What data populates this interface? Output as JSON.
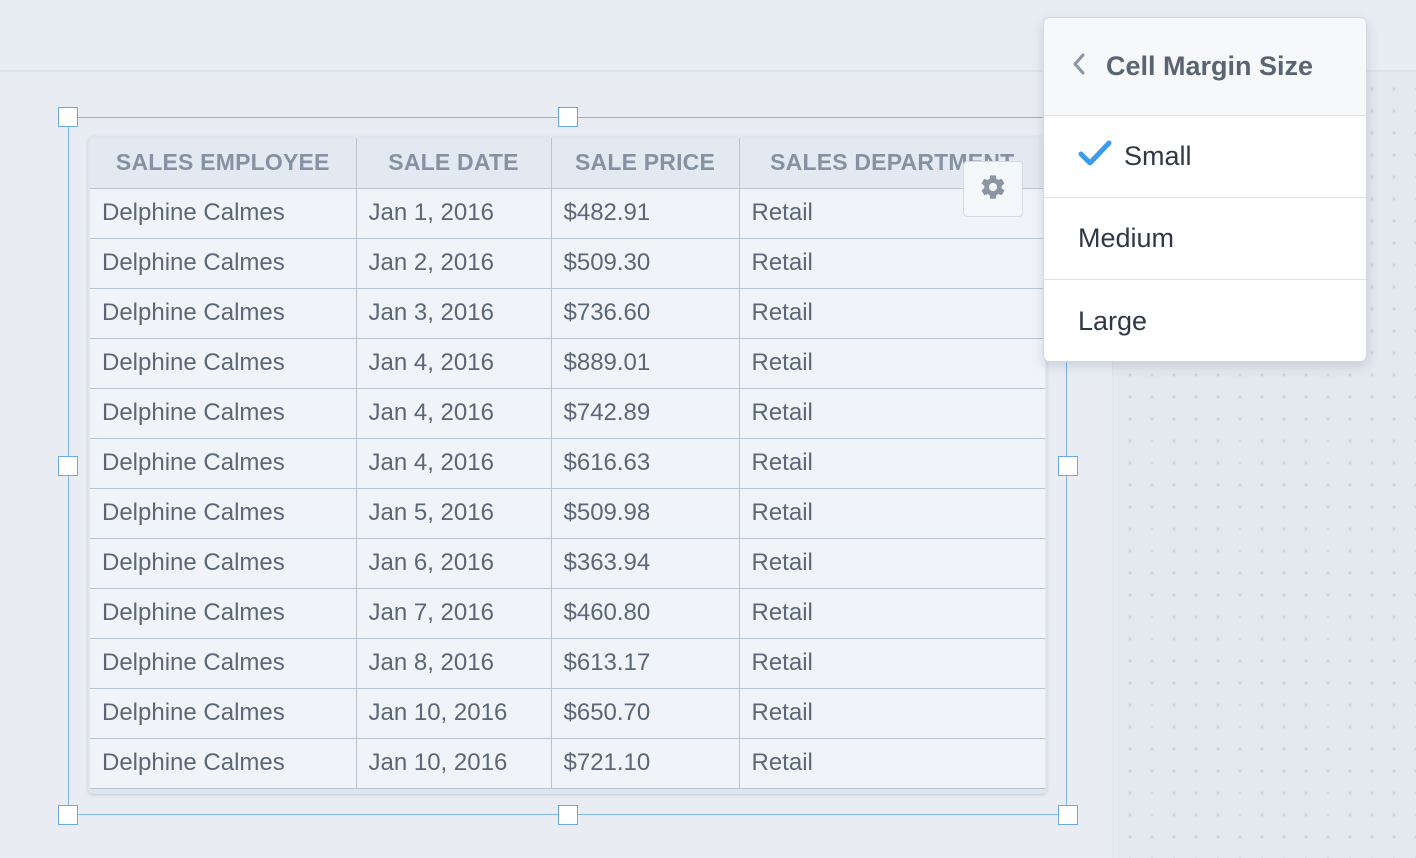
{
  "table": {
    "columns": [
      "SALES EMPLOYEE",
      "SALE DATE",
      "SALE PRICE",
      "SALES DEPARTMENT"
    ],
    "rows": [
      [
        "Delphine Calmes",
        "Jan 1, 2016",
        "$482.91",
        "Retail"
      ],
      [
        "Delphine Calmes",
        "Jan 2, 2016",
        "$509.30",
        "Retail"
      ],
      [
        "Delphine Calmes",
        "Jan 3, 2016",
        "$736.60",
        "Retail"
      ],
      [
        "Delphine Calmes",
        "Jan 4, 2016",
        "$889.01",
        "Retail"
      ],
      [
        "Delphine Calmes",
        "Jan 4, 2016",
        "$742.89",
        "Retail"
      ],
      [
        "Delphine Calmes",
        "Jan 4, 2016",
        "$616.63",
        "Retail"
      ],
      [
        "Delphine Calmes",
        "Jan 5, 2016",
        "$509.98",
        "Retail"
      ],
      [
        "Delphine Calmes",
        "Jan 6, 2016",
        "$363.94",
        "Retail"
      ],
      [
        "Delphine Calmes",
        "Jan 7, 2016",
        "$460.80",
        "Retail"
      ],
      [
        "Delphine Calmes",
        "Jan 8, 2016",
        "$613.17",
        "Retail"
      ],
      [
        "Delphine Calmes",
        "Jan 10, 2016",
        "$650.70",
        "Retail"
      ],
      [
        "Delphine Calmes",
        "Jan 10, 2016",
        "$721.10",
        "Retail"
      ]
    ]
  },
  "gear_button": {
    "icon": "gear-icon"
  },
  "dropdown": {
    "back_icon": "chevron-left-icon",
    "title": "Cell Margin Size",
    "options": [
      {
        "label": "Small",
        "selected": true
      },
      {
        "label": "Medium",
        "selected": false
      },
      {
        "label": "Large",
        "selected": false
      }
    ],
    "check_color": "#3d9be9"
  },
  "colors": {
    "selection": "#7fb4ee",
    "header_text": "#8492a3",
    "cell_text": "#5b6677"
  }
}
